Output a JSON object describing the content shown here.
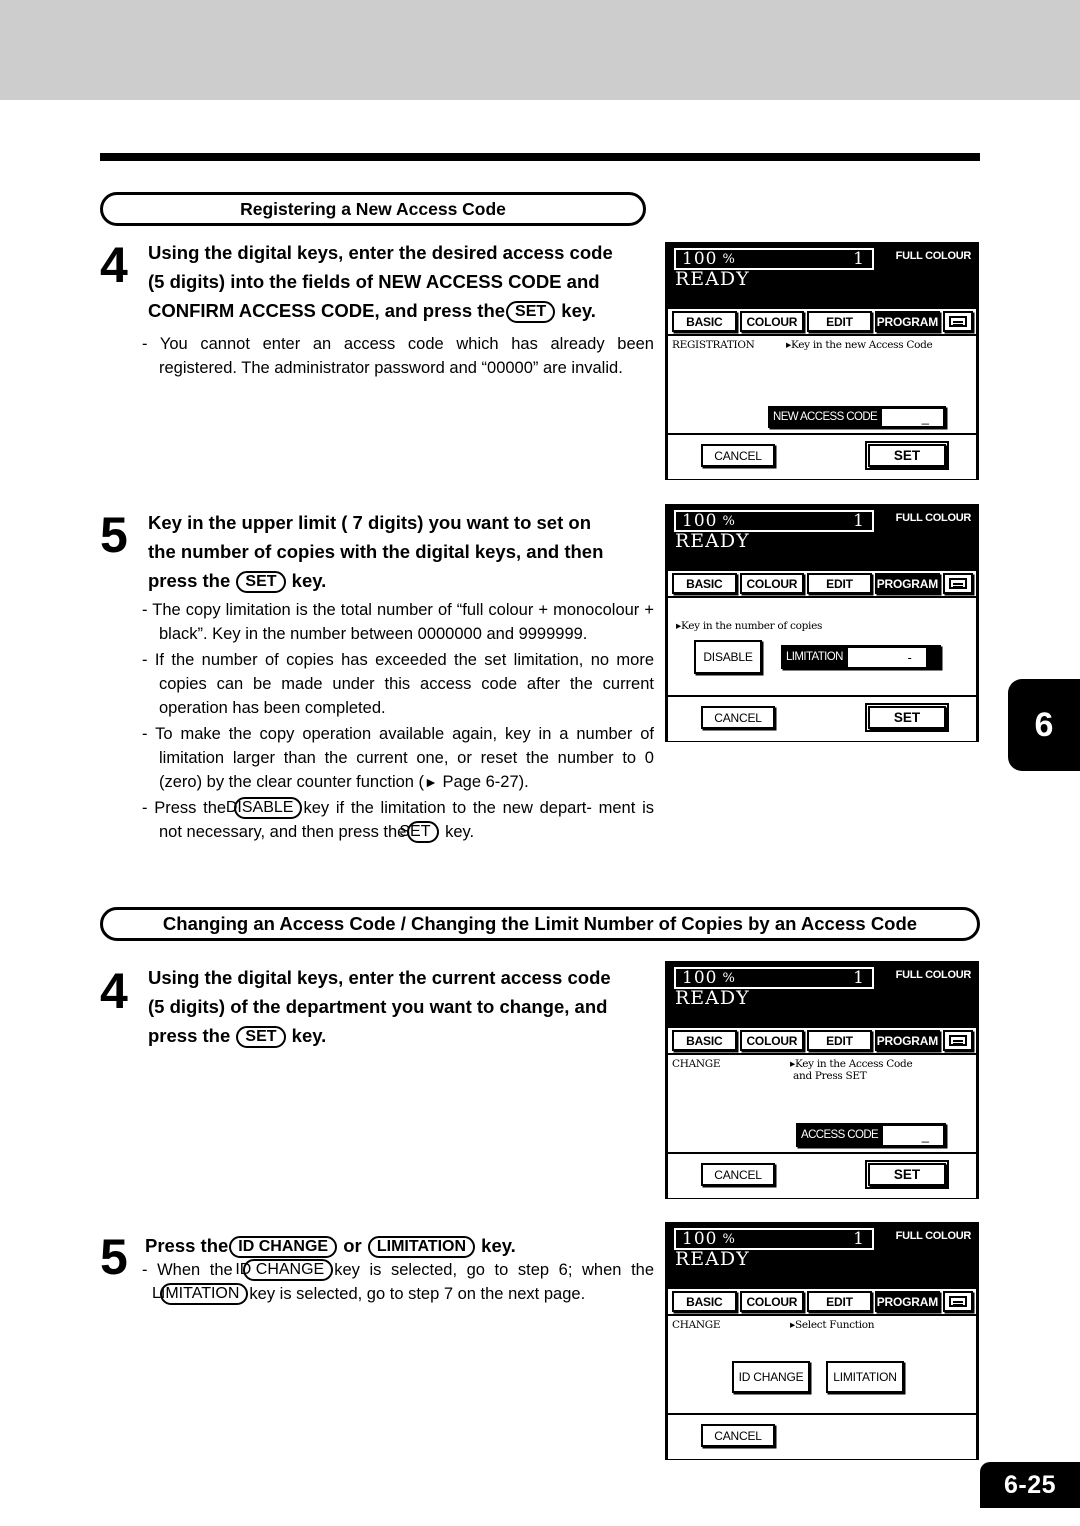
{
  "page": {
    "chapter_tab": "6",
    "page_number": "6-25"
  },
  "sections": [
    {
      "id": "registering",
      "title": "Registering a New Access Code",
      "steps": [
        {
          "number": "4",
          "head_line_1": "Using the digital keys, enter the desired access code",
          "head_line_2": "(5 digits) into the fields of  NEW ACCESS CODE and",
          "head_line_3_a": "CONFIRM ACCESS CODE, and press the",
          "head_key": "SET",
          "head_line_3_b": "key.",
          "bullets": [
            "- You cannot enter an access code which has already been registered.  The administrator password and “00000” are invalid."
          ]
        },
        {
          "number": "5",
          "head_line_1": "Key in the upper limit ( 7 digits) you want to set on",
          "head_line_2": "the number of copies with the digital keys, and then",
          "head_line_3_a": "press the",
          "head_key": "SET",
          "head_line_3_b": "key.",
          "bullets": [
            "- The copy limitation is the total number of “full colour + monocolour + black”.  Key in the number between 0000000 and 9999999.",
            "- If the number of copies has exceeded the set limitation, no more copies can be made under this access code after the current operation has been completed."
          ],
          "bullet_page_ref_a": "- To make the copy operation available again, key in a number of limitation larger than the current one, or reset the number to 0 (zero) by the clear counter function (",
          "bullet_page_ref_arrow": "►",
          "bullet_page_ref_b": " Page 6-27).",
          "bullet_disable_a": "- Press the",
          "bullet_disable_key": "DISABLE",
          "bullet_disable_b": "key if the limitation to the new depart-",
          "bullet_disable_c": "ment is not necessary, and then press the",
          "bullet_disable_key2": "SET",
          "bullet_disable_d": "key."
        }
      ]
    },
    {
      "id": "changing",
      "title": "Changing an Access Code / Changing the Limit Number of Copies by an Access Code",
      "steps": [
        {
          "number": "4",
          "head_line_1": "Using the digital keys, enter the current access code",
          "head_line_2": "(5 digits) of the department you want to change, and",
          "head_line_3_a": "press the",
          "head_key": "SET",
          "head_line_3_b": "key."
        },
        {
          "number": "5",
          "head_a": "Press the",
          "head_key_1": "ID CHANGE",
          "head_mid": "or",
          "head_key_2": "LIMITATION",
          "head_b": "key.",
          "bullet_a": "- When the",
          "bullet_key_1": "ID CHANGE",
          "bullet_b": "key is selected, go to step 6; when",
          "bullet_c": "the",
          "bullet_key_2": "LIMITATION",
          "bullet_d": "key is selected, go to step 7 on the next",
          "bullet_e": "page."
        }
      ]
    }
  ],
  "lcd_common": {
    "ratio": "100",
    "percent_symbol": "%",
    "quantity": "1",
    "colour_mode": "FULL COLOUR",
    "ready": "READY",
    "tabs": [
      {
        "label": "BASIC",
        "active": false
      },
      {
        "label": "COLOUR",
        "active": false
      },
      {
        "label": "EDIT",
        "active": false
      },
      {
        "label": "PROGRAM",
        "active": true
      }
    ],
    "tab_icon_name": "control-panel-icon"
  },
  "lcd_panels": [
    {
      "id": "panel-registration",
      "status": "REGISTRATION",
      "message": "▸Key in the new Access Code",
      "fields": [
        {
          "label": "NEW ACCESS CODE",
          "value": "_"
        },
        {
          "label": "CONFIRM ACCESS CODE",
          "value": ""
        }
      ],
      "buttons": [
        {
          "label": "CANCEL",
          "style": "soft"
        },
        {
          "label": "SET",
          "style": "bold"
        }
      ]
    },
    {
      "id": "panel-limitation",
      "status": "",
      "message": "▸Key in the number of copies",
      "disable_button": "DISABLE",
      "fields": [
        {
          "label": "LIMITATION",
          "value": "-"
        }
      ],
      "buttons": [
        {
          "label": "CANCEL",
          "style": "soft"
        },
        {
          "label": "SET",
          "style": "bold"
        }
      ]
    },
    {
      "id": "panel-change-code",
      "status": "CHANGE",
      "message": "▸Key in the Access Code\n and Press SET",
      "fields": [
        {
          "label": "ACCESS CODE",
          "value": "_"
        }
      ],
      "buttons": [
        {
          "label": "CANCEL",
          "style": "soft"
        },
        {
          "label": "SET",
          "style": "bold"
        }
      ]
    },
    {
      "id": "panel-select-function",
      "status": "CHANGE",
      "message": "▸Select Function",
      "choice_buttons": [
        {
          "label": "ID CHANGE"
        },
        {
          "label": "LIMITATION"
        }
      ],
      "buttons": [
        {
          "label": "CANCEL",
          "style": "soft"
        }
      ]
    }
  ]
}
